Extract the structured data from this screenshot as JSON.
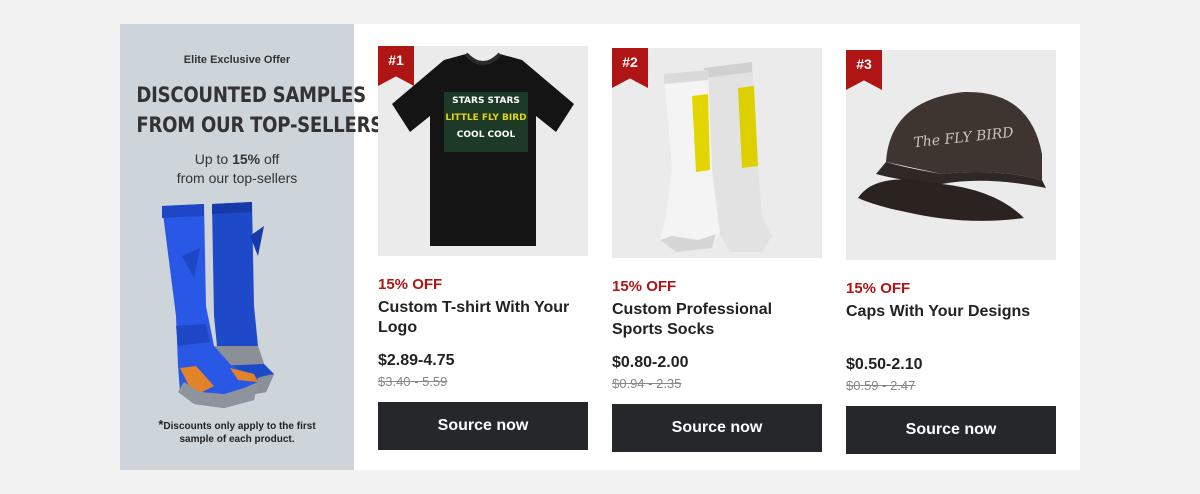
{
  "promo": {
    "eyebrow": "Elite Exclusive Offer",
    "headline_line1": "DISCOUNTED SAMPLES",
    "headline_line2": "FROM OUR TOP-SELLERS",
    "headline_mark": "*",
    "sub_prefix": "Up to ",
    "sub_percent": "15%",
    "sub_suffix": " off",
    "sub_line2": "from our top-sellers",
    "note_mark": "*",
    "note_text": "Discounts only apply to the first sample of each product."
  },
  "products": [
    {
      "rank": "#1",
      "discount": "15% OFF",
      "title": "Custom T-shirt With Your Logo",
      "price": "$2.89-4.75",
      "original_price": "$3.40 - 5.59",
      "button": "Source now",
      "image_text": [
        "STARS STARS",
        "LITTLE FLY BIRD",
        "COOL COOL"
      ]
    },
    {
      "rank": "#2",
      "discount": "15% OFF",
      "title": "Custom Professional Sports Socks",
      "price": "$0.80-2.00",
      "original_price": "$0.94 - 2.35",
      "button": "Source now"
    },
    {
      "rank": "#3",
      "discount": "15% OFF",
      "title": "Caps With Your Designs",
      "price": "$0.50-2.10",
      "original_price": "$0.59 - 2.47",
      "button": "Source now",
      "image_text": [
        "The FLY BIRD"
      ]
    }
  ],
  "colors": {
    "page_bg": "#f2f2f2",
    "promo_bg": "#cdd4da",
    "accent_red": "#b01515",
    "button_bg": "#26272b",
    "sock_blue": "#1f4fd6",
    "sock_accent": "#e0e000"
  }
}
